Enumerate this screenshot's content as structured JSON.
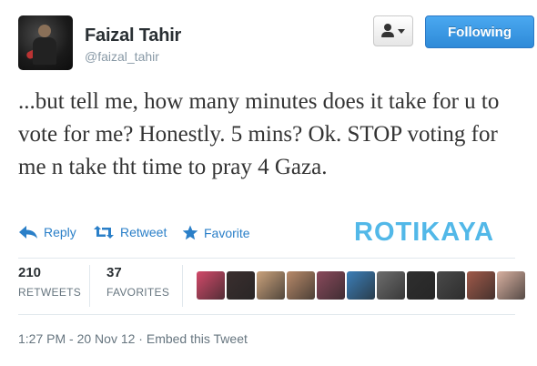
{
  "user": {
    "name": "Faizal Tahir",
    "handle": "@faizal_tahir"
  },
  "header": {
    "user_menu_icon": "person-icon",
    "follow_label": "Following",
    "follow_color": "#2e8ad8"
  },
  "tweet": {
    "text": "...but tell me, how many minutes does it take for u to vote for me? Honestly. 5 mins? Ok. STOP voting for me n take tht time to pray 4 Gaza."
  },
  "actions": {
    "reply_label": "Reply",
    "reply_icon": "reply-arrow-icon",
    "retweet_label": "Retweet",
    "retweet_icon": "retweet-icon",
    "favorite_label": "Favorite",
    "favorite_icon": "star-icon",
    "accent_color": "#2a7fc8"
  },
  "watermark": "ROTIKAYA",
  "stats": {
    "retweets_count": "210",
    "retweets_label": "RETWEETS",
    "favorites_count": "37",
    "favorites_label": "FAVORITES"
  },
  "favoriters": [
    {
      "color": "#d24a6a"
    },
    {
      "color": "#3b2f2f"
    },
    {
      "color": "#caa27c"
    },
    {
      "color": "#b88a6a"
    },
    {
      "color": "#8a4a5c"
    },
    {
      "color": "#3c7fb8"
    },
    {
      "color": "#6e6e6e"
    },
    {
      "color": "#2f2f2f"
    },
    {
      "color": "#4a4a4a"
    },
    {
      "color": "#a05a4a"
    },
    {
      "color": "#d8b0a0"
    }
  ],
  "footer": {
    "timestamp": "1:27 PM - 20 Nov 12",
    "separator": " · ",
    "embed_label": "Embed this Tweet"
  }
}
